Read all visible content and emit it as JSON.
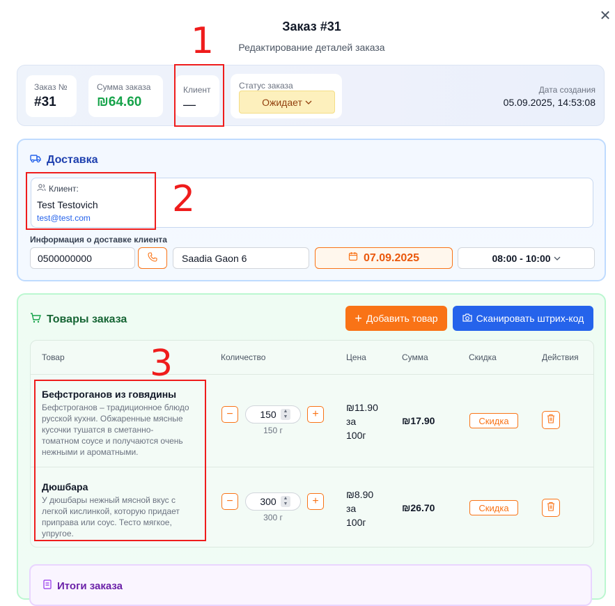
{
  "modal": {
    "title": "Заказ #31",
    "subtitle": "Редактирование деталей заказа",
    "close_icon": "close-icon"
  },
  "summary": {
    "order_no_label": "Заказ №",
    "order_no_value": "#31",
    "total_label": "Сумма заказа",
    "total_value": "₪64.60",
    "client_label": "Клиент",
    "client_value": "—",
    "status_label": "Статус заказа",
    "status_value": "Ожидает",
    "created_label": "Дата создания",
    "created_value": "05.09.2025, 14:53:08"
  },
  "delivery": {
    "title": "Доставка",
    "client_label": "Клиент:",
    "client_name": "Test Testovich",
    "client_email": "test@test.com",
    "info_label": "Информация о доставке клиента",
    "phone": "0500000000",
    "address": "Saadia Gaon 6",
    "date": "07.09.2025",
    "time": "08:00 - 10:00"
  },
  "products": {
    "title": "Товары заказа",
    "add_button": "Добавить товар",
    "scan_button": "Сканировать штрих-код",
    "columns": [
      "Товар",
      "Количество",
      "Цена",
      "Сумма",
      "Скидка",
      "Действия"
    ],
    "items": [
      {
        "name": "Бефстроганов из говядины",
        "desc": [
          "Бефстроганов – традиционное блюдо",
          "русской кухни. Обжаренные мясные",
          "кусочки тушатся в сметанно-",
          "томатном соусе и получаются очень",
          "нежными и ароматными."
        ],
        "qty": "150",
        "unit": "150 г",
        "price_lines": [
          "₪11.90",
          "за",
          "100г"
        ],
        "sum": "₪17.90",
        "discount": "Скидка"
      },
      {
        "name": "Дюшбара",
        "desc": [
          "У дюшбары нежный мясной вкус с",
          "легкой кислинкой, которую придает",
          "приправа или соус. Тесто мягкое,",
          "упругое."
        ],
        "qty": "300",
        "unit": "300 г",
        "price_lines": [
          "₪8.90",
          "за",
          "100г"
        ],
        "sum": "₪26.70",
        "discount": "Скидка"
      }
    ]
  },
  "totals": {
    "title": "Итоги заказа"
  },
  "annotations": {
    "labels": [
      "1",
      "2",
      "3"
    ],
    "color": "#ef1c1c"
  },
  "colors": {
    "accent_orange": "#f97316",
    "accent_blue": "#2563eb",
    "green": "#16a34a",
    "delivery_title": "#1e40af",
    "products_title": "#166534"
  }
}
